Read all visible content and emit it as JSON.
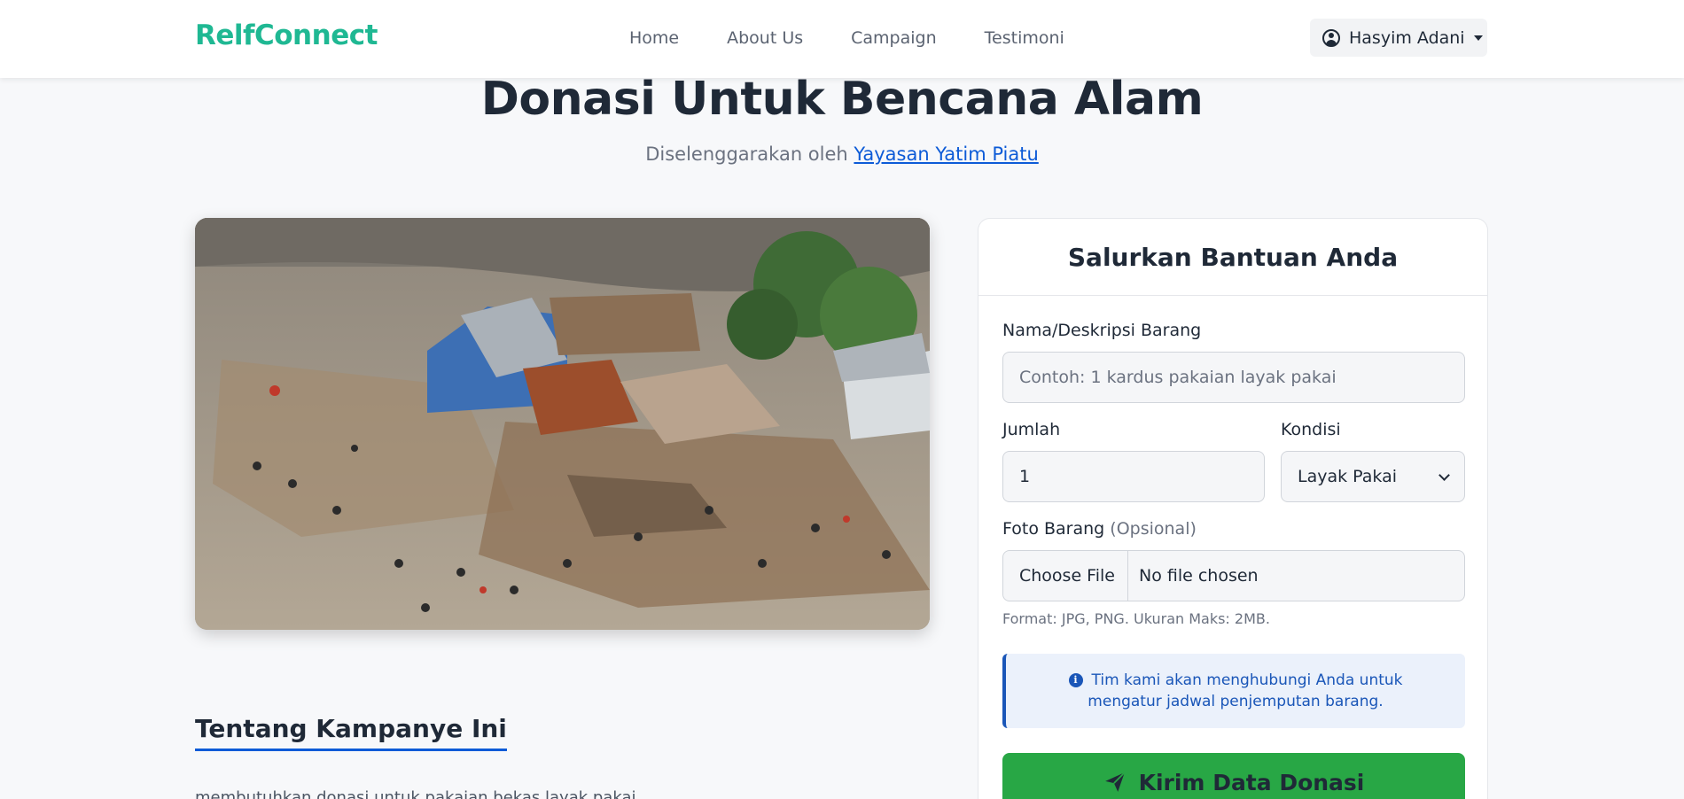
{
  "navbar": {
    "brand": "RelfConnect",
    "links": [
      "Home",
      "About Us",
      "Campaign",
      "Testimoni"
    ],
    "user": {
      "name": "Hasyim Adani",
      "icon": "user-circle-icon"
    }
  },
  "campaign": {
    "title": "Donasi Untuk Bencana Alam",
    "subtitle_prefix": "Diselenggarakan oleh",
    "organizer": "Yayasan Yatim Piatu",
    "image_alt": "Aerial photo of flood disaster debris",
    "about_title": "Tentang Kampanye Ini",
    "description": "membutuhkan donasi untuk pakaian bekas layak pakai"
  },
  "form": {
    "title": "Salurkan Bantuan Anda",
    "item_label": "Nama/Deskripsi Barang",
    "item_placeholder": "Contoh: 1 kardus pakaian layak pakai",
    "qty_label": "Jumlah",
    "qty_value": "1",
    "condition_label": "Kondisi",
    "condition_value": "Layak Pakai",
    "photo_label": "Foto Barang",
    "photo_optional": "(Opsional)",
    "file_button": "Choose File",
    "file_status": "No file chosen",
    "file_hint": "Format: JPG, PNG. Ukuran Maks: 2MB.",
    "info_text": "Tim kami akan menghubungi Anda untuk mengatur jadwal penjemputan barang.",
    "submit_label": "Kirim Data Donasi"
  },
  "colors": {
    "brand": "#1fb893",
    "link": "#0d5bd7",
    "submit": "#28a745",
    "info": "#1a56b8"
  }
}
